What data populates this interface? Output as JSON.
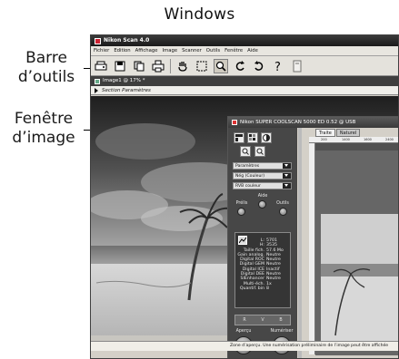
{
  "figure": {
    "caption": "Windows",
    "callouts": [
      {
        "id": "toolbar",
        "text_line1": "Barre",
        "text_line2": "d’outils"
      },
      {
        "id": "image",
        "text_line1": "Fenêtre",
        "text_line2": "d’image"
      }
    ]
  },
  "app": {
    "title": "Nikon Scan 4.0",
    "menu": [
      "Fichier",
      "Edition",
      "Affichage",
      "Image",
      "Scanner",
      "Outils",
      "Fenêtre",
      "Aide"
    ],
    "toolbar_icons": [
      "scan-icon",
      "save-icon",
      "copy-icon",
      "print-icon",
      "hand-icon",
      "crop-icon",
      "zoom-icon",
      "rotate-left-icon",
      "rotate-right-icon",
      "help-icon",
      "document-icon"
    ]
  },
  "image_window": {
    "title": "Image1 @ 17% *",
    "section": "Section Paramètres"
  },
  "scanner_window": {
    "title": "Nikon SUPER COOLSCAN 5000 ED 0.52 @ USB",
    "tabs": [
      "Traite",
      "Naturel"
    ],
    "dropdowns": [
      "Paramètres",
      "Nég (Couleur)",
      "RVB couleur"
    ],
    "control_labels": [
      "Prélis",
      "Aide",
      "Outils"
    ],
    "info_rows": [
      {
        "k": "L:",
        "v": "5701"
      },
      {
        "k": "H:",
        "v": "3535"
      },
      {
        "k": "Taille fich.",
        "v": "57.6 Mo"
      },
      {
        "k": "Gain analog.",
        "v": "Neutre"
      },
      {
        "k": "Digital ROC",
        "v": "Neutre"
      },
      {
        "k": "Digital GEM",
        "v": "Neutre"
      },
      {
        "k": "Digital ICE",
        "v": "Inactif"
      },
      {
        "k": "Digital DEE",
        "v": "Neutre"
      },
      {
        "k": "SIEnhancer",
        "v": "Neutre"
      },
      {
        "k": "Multi-éch.",
        "v": "1x"
      },
      {
        "k": "Quantif. bin",
        "v": "8"
      }
    ],
    "channels": [
      "R",
      "V",
      "B"
    ],
    "action_labels": [
      "Aperçu",
      "Numériser"
    ],
    "ruler_labels": [
      "200",
      "1400",
      "1600",
      "2400"
    ],
    "status_text": "Zone d’aperçu. Une numérisation préliminaire de l’image peut être affichée"
  }
}
